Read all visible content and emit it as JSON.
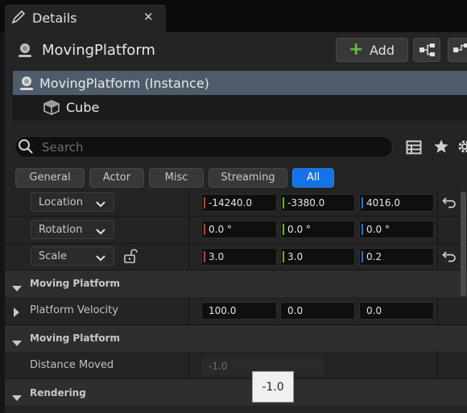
{
  "window": {
    "tab_title": "Details",
    "close_glyph": "✕"
  },
  "actor": {
    "title": "MovingPlatform",
    "add_label": "Add",
    "add_glyph": "+"
  },
  "tree": {
    "instance": "MovingPlatform (Instance)",
    "component": "Cube"
  },
  "search": {
    "placeholder": "Search"
  },
  "filters": [
    {
      "label": "General"
    },
    {
      "label": "Actor"
    },
    {
      "label": "Misc"
    },
    {
      "label": "Streaming"
    },
    {
      "label": "All",
      "active": true
    }
  ],
  "transform": {
    "location": {
      "label": "Location",
      "x": "-14240.0",
      "y": "-3380.0",
      "z": "4016.0"
    },
    "rotation": {
      "label": "Rotation",
      "x": "0.0 °",
      "y": "0.0 °",
      "z": "0.0 °"
    },
    "scale": {
      "label": "Scale",
      "x": "3.0",
      "y": "3.0",
      "z": "0.2"
    }
  },
  "moving_platform_1": {
    "title": "Moving Platform",
    "velocity": {
      "label": "Platform Velocity",
      "x": "100.0",
      "y": "0.0",
      "z": "0.0"
    }
  },
  "moving_platform_2": {
    "title": "Moving Platform",
    "distance": {
      "label": "Distance Moved",
      "value": "-1.0"
    }
  },
  "rendering": {
    "title": "Rendering"
  },
  "tooltip": {
    "text": "-1.0"
  },
  "colors": {
    "x_axis": "#c8382c",
    "y_axis": "#6fae2c",
    "z_axis": "#2d6fd6",
    "selection": "#4e5b6b",
    "accent": "#1473e6"
  }
}
